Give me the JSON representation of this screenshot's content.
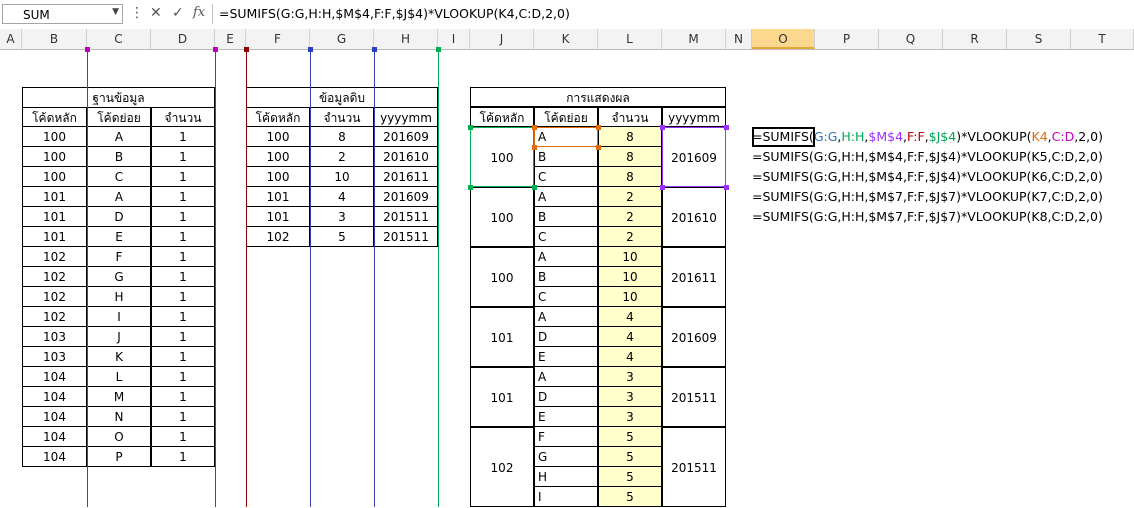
{
  "name_box": "SUM",
  "formula_bar": {
    "cancel_icon": "✕",
    "enter_icon": "✓",
    "fx_label": "fx",
    "text": "=SUMIFS(G:G,H:H,$M$4,F:F,$J$4)*VLOOKUP(K4,C:D,2,0)"
  },
  "columns": [
    "A",
    "B",
    "C",
    "D",
    "E",
    "F",
    "G",
    "H",
    "I",
    "J",
    "K",
    "L",
    "M",
    "N",
    "O",
    "P",
    "Q",
    "R",
    "S",
    "T"
  ],
  "database": {
    "title": "ฐานข้อมูล",
    "headers": [
      "โค้ดหลัก",
      "โค้ดย่อย",
      "จำนวน"
    ],
    "rows": [
      [
        "100",
        "A",
        "1"
      ],
      [
        "100",
        "B",
        "1"
      ],
      [
        "100",
        "C",
        "1"
      ],
      [
        "101",
        "A",
        "1"
      ],
      [
        "101",
        "D",
        "1"
      ],
      [
        "101",
        "E",
        "1"
      ],
      [
        "102",
        "F",
        "1"
      ],
      [
        "102",
        "G",
        "1"
      ],
      [
        "102",
        "H",
        "1"
      ],
      [
        "102",
        "I",
        "1"
      ],
      [
        "103",
        "J",
        "1"
      ],
      [
        "103",
        "K",
        "1"
      ],
      [
        "104",
        "L",
        "1"
      ],
      [
        "104",
        "M",
        "1"
      ],
      [
        "104",
        "N",
        "1"
      ],
      [
        "104",
        "O",
        "1"
      ],
      [
        "104",
        "P",
        "1"
      ]
    ]
  },
  "raw_data": {
    "title": "ข้อมูลดิบ",
    "headers": [
      "โค้ดหลัก",
      "จำนวน",
      "yyyymm"
    ],
    "rows": [
      [
        "100",
        "8",
        "201609"
      ],
      [
        "100",
        "2",
        "201610"
      ],
      [
        "100",
        "10",
        "201611"
      ],
      [
        "101",
        "4",
        "201609"
      ],
      [
        "101",
        "3",
        "201511"
      ],
      [
        "102",
        "5",
        "201511"
      ]
    ]
  },
  "display": {
    "title": "การแสดงผล",
    "headers": [
      "โค้ดหลัก",
      "โค้ดย่อย",
      "จำนวน",
      "yyyymm"
    ],
    "groups": [
      {
        "code": "100",
        "period": "201609",
        "items": [
          [
            "A",
            "8"
          ],
          [
            "B",
            "8"
          ],
          [
            "C",
            "8"
          ]
        ]
      },
      {
        "code": "100",
        "period": "201610",
        "items": [
          [
            "A",
            "2"
          ],
          [
            "B",
            "2"
          ],
          [
            "C",
            "2"
          ]
        ]
      },
      {
        "code": "100",
        "period": "201611",
        "items": [
          [
            "A",
            "10"
          ],
          [
            "B",
            "10"
          ],
          [
            "C",
            "10"
          ]
        ]
      },
      {
        "code": "101",
        "period": "201609",
        "items": [
          [
            "A",
            "4"
          ],
          [
            "D",
            "4"
          ],
          [
            "E",
            "4"
          ]
        ]
      },
      {
        "code": "101",
        "period": "201511",
        "items": [
          [
            "A",
            "3"
          ],
          [
            "D",
            "3"
          ],
          [
            "E",
            "3"
          ]
        ]
      },
      {
        "code": "102",
        "period": "201511",
        "items": [
          [
            "F",
            "5"
          ],
          [
            "G",
            "5"
          ],
          [
            "H",
            "5"
          ],
          [
            "I",
            "5"
          ]
        ]
      }
    ]
  },
  "formula_texts": [
    [
      [
        "=SUMIFS(",
        "#000000"
      ],
      [
        "G:G",
        "#2e74b5"
      ],
      [
        ",",
        "#000000"
      ],
      [
        "H:H",
        "#00a651"
      ],
      [
        ",",
        "#000000"
      ],
      [
        "$M$4",
        "#9b30ff"
      ],
      [
        ",",
        "#000000"
      ],
      [
        "F:F",
        "#c00000"
      ],
      [
        ",",
        "#000000"
      ],
      [
        "$J$4",
        "#00a651"
      ],
      [
        ")*VLOOKUP(",
        "#000000"
      ],
      [
        "K4",
        "#e26b0a"
      ],
      [
        ",",
        "#000000"
      ],
      [
        "C:D",
        "#c000c0"
      ],
      [
        ",2,0)",
        "#000000"
      ]
    ],
    [
      [
        "=SUMIFS(G:G,H:H,$M$4,F:F,$J$4)*VLOOKUP(K5,C:D,2,0)",
        "#000000"
      ]
    ],
    [
      [
        "=SUMIFS(G:G,H:H,$M$4,F:F,$J$4)*VLOOKUP(K6,C:D,2,0)",
        "#000000"
      ]
    ],
    [
      [
        "=SUMIFS(G:G,H:H,$M$7,F:F,$J$7)*VLOOKUP(K7,C:D,2,0)",
        "#000000"
      ]
    ],
    [
      [
        "=SUMIFS(G:G,H:H,$M$7,F:F,$J$7)*VLOOKUP(K8,C:D,2,0)",
        "#000000"
      ]
    ]
  ],
  "colors": {
    "active_col": "#fbd88d",
    "highlight": "#ffffcc",
    "ref_green": "#00b050",
    "ref_orange": "#e26b0a",
    "ref_purple": "#9b30ff",
    "ref_magenta": "#c000c0",
    "ref_darkred": "#8b0000",
    "ref_blue": "#2e3fbf"
  }
}
